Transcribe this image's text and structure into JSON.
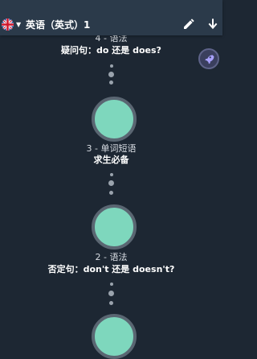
{
  "header": {
    "course_title": "英语（英式）1",
    "flag_icon": "uk-flag-icon",
    "caret_icon": "caret-down-icon",
    "edit_icon": "pencil-icon",
    "download_icon": "download-arrow-icon"
  },
  "rocket_icon": "rocket-icon",
  "lessons": [
    {
      "meta": "4 - 语法",
      "title": "疑问句：do 还是 does?"
    },
    {
      "meta": "3 - 单词短语",
      "title": "求生必备"
    },
    {
      "meta": "2 - 语法",
      "title": "否定句：don't 还是 doesn't?"
    }
  ],
  "colors": {
    "background": "#1d2733",
    "topbar": "#2b3a4a",
    "node_fill": "#7ed7bd",
    "node_ring": "#5a6672",
    "connector_dot": "#9aa3ad",
    "rocket_bg": "#3a3f5e",
    "rocket_icon": "#a9a2ff"
  }
}
